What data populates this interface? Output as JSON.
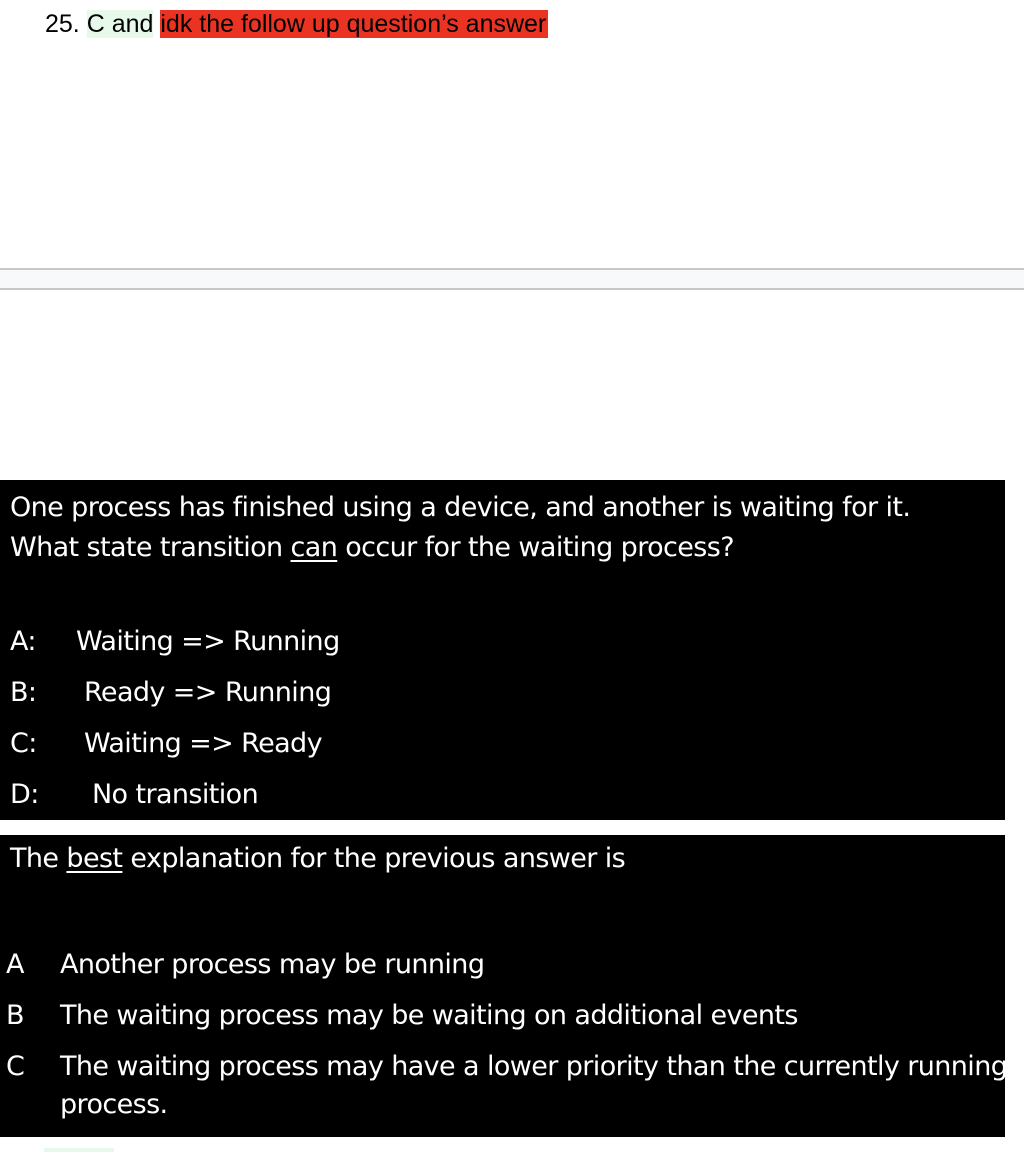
{
  "note": {
    "prefix": "25. ",
    "answer": "C and",
    "comment": "idk the follow up question’s answer"
  },
  "slide1": {
    "question_part1": "One process has finished using a device, and another is waiting for it.",
    "question_part2_pre": "What state transition ",
    "question_part2_emph": "can",
    "question_part2_post": " occur for the waiting process?",
    "options": [
      {
        "label": "A:",
        "text": "Waiting => Running"
      },
      {
        "label": "B:",
        "text": " Ready => Running"
      },
      {
        "label": "C:",
        "text": " Waiting => Ready"
      },
      {
        "label": "D:",
        "text": "  No transition"
      }
    ]
  },
  "slide2": {
    "question_pre": "The ",
    "question_emph": "best",
    "question_post": " explanation for the previous answer is",
    "options": [
      {
        "label": "A",
        "text": "Another process may be running"
      },
      {
        "label": "B",
        "text": "The waiting process may be waiting on additional events"
      },
      {
        "label": "C",
        "text": "The waiting process may have a lower priority than the currently running process."
      }
    ]
  }
}
